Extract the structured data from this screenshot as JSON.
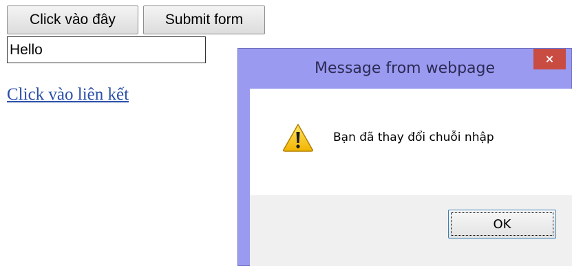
{
  "page": {
    "button_primary": "Click vào đây",
    "button_submit": "Submit form",
    "input_value": "Hello",
    "link_text": "Click vào liên kết"
  },
  "dialog": {
    "title": "Message from webpage",
    "close_glyph": "×",
    "message": "Bạn đã thay đổi chuỗi nhập",
    "ok_label": "OK",
    "icon": "warning-icon"
  },
  "colors": {
    "dialog_frame": "#9a9af0",
    "close_button": "#c94c43",
    "link": "#2a4fa8",
    "footer": "#f0f0f0"
  }
}
